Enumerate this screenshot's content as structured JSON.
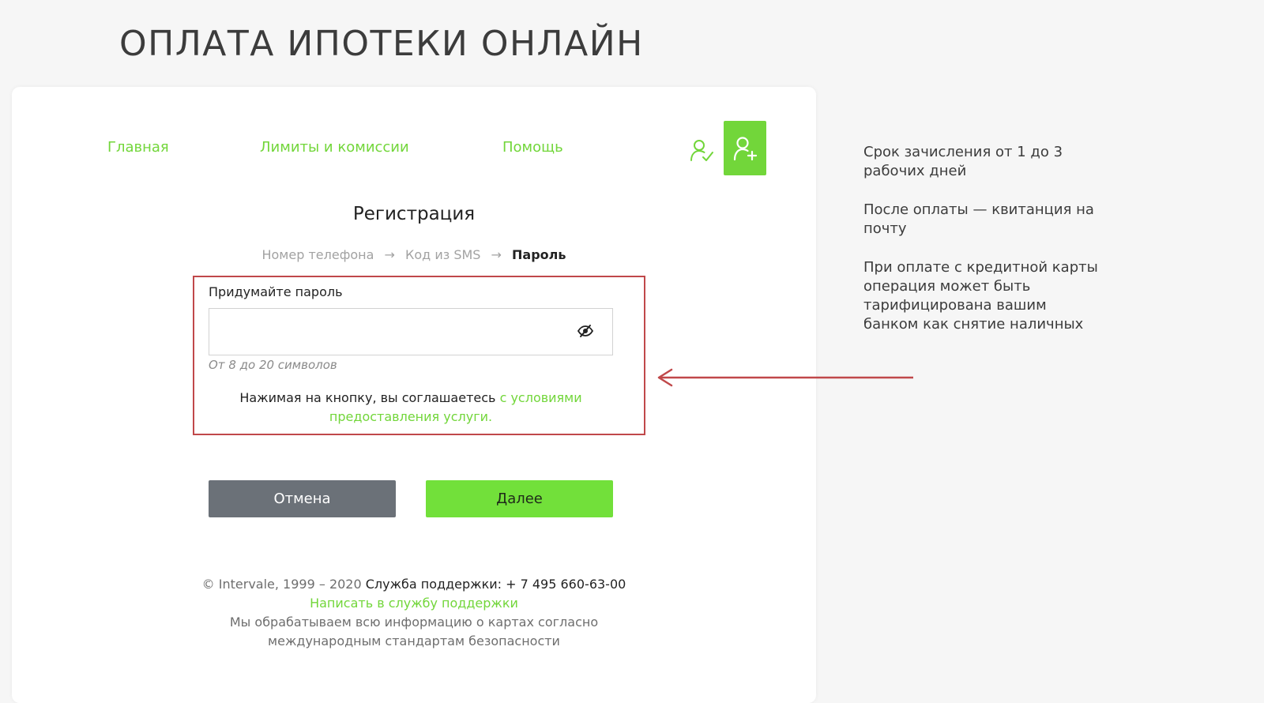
{
  "page": {
    "title": "ОПЛАТА ИПОТЕКИ ОНЛАЙН"
  },
  "nav": {
    "items": [
      {
        "label": "Главная"
      },
      {
        "label": "Лимиты и комиссии"
      },
      {
        "label": "Помощь"
      }
    ]
  },
  "form": {
    "title": "Регистрация",
    "steps": [
      {
        "label": "Номер телефона"
      },
      {
        "label": "Код из SMS"
      },
      {
        "label": "Пароль"
      }
    ],
    "step_separator": "→",
    "password_label": "Придумайте пароль",
    "password_value": "",
    "password_hint": "От 8 до 20 символов",
    "agreement_text": "Нажимая на кнопку, вы соглашаетесь",
    "agreement_link": "с условиями предоставления услуги.",
    "cancel_label": "Отмена",
    "next_label": "Далее"
  },
  "footer": {
    "copyright": "© Intervale, 1999 – 2020",
    "support_phone": "Служба поддержки: + 7 495 660-63-00",
    "support_link": "Написать в службу поддержки",
    "security_note": "Мы обрабатываем всю информацию о картах согласно международным стандартам безопасности"
  },
  "side_info": {
    "items": [
      "Срок зачисления от 1 до 3 рабочих дней",
      "После оплаты — квитанция на почту",
      "При оплате с кредитной карты операция может быть тарифицирована вашим банком как снятие наличных"
    ]
  },
  "colors": {
    "accent": "#72d63a",
    "cancel_button": "#6b7178",
    "annotation": "#c0484a",
    "title": "#3c3c3c"
  },
  "icons": {
    "login": "user-check-icon",
    "register": "user-plus-icon",
    "toggle_password": "eye-slash-icon",
    "annotation": "arrow-left-icon"
  }
}
